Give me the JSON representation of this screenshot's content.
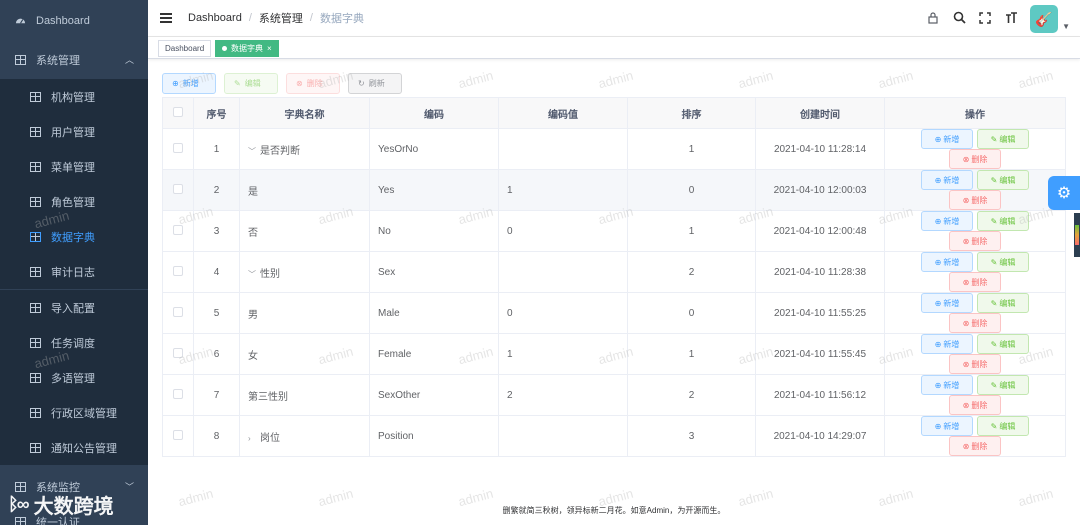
{
  "sidebar": {
    "dashboard": "Dashboard",
    "system_management": "系统管理",
    "items": [
      {
        "label": "机构管理"
      },
      {
        "label": "用户管理"
      },
      {
        "label": "菜单管理"
      },
      {
        "label": "角色管理"
      },
      {
        "label": "数据字典"
      },
      {
        "label": "审计日志"
      },
      {
        "label": "导入配置"
      },
      {
        "label": "任务调度"
      },
      {
        "label": "多语管理"
      },
      {
        "label": "行政区域管理"
      },
      {
        "label": "通知公告管理"
      }
    ],
    "system_monitor": "系统监控",
    "system_tool": "统一认证",
    "logo_text": "大数跨境",
    "active_color": "#409eff"
  },
  "header": {
    "breadcrumb": [
      "Dashboard",
      "系统管理",
      "数据字典"
    ]
  },
  "tags": {
    "dashboard": "Dashboard",
    "active": "数据字典",
    "close": "×"
  },
  "toolbar": {
    "add": "新增",
    "edit": "编辑",
    "delete": "删除",
    "refresh": "刷新"
  },
  "table": {
    "headers": [
      "序号",
      "字典名称",
      "编码",
      "编码值",
      "排序",
      "创建时间",
      "操作"
    ],
    "rows": [
      {
        "seq": "1",
        "name": "是否判断",
        "code": "YesOrNo",
        "value": "",
        "sort": "1",
        "time": "2021-04-10 11:28:14"
      },
      {
        "seq": "2",
        "name": "是",
        "code": "Yes",
        "value": "1",
        "sort": "0",
        "time": "2021-04-10 12:00:03"
      },
      {
        "seq": "3",
        "name": "否",
        "code": "No",
        "value": "0",
        "sort": "1",
        "time": "2021-04-10 12:00:48"
      },
      {
        "seq": "4",
        "name": "性别",
        "code": "Sex",
        "value": "",
        "sort": "2",
        "time": "2021-04-10 11:28:38"
      },
      {
        "seq": "5",
        "name": "男",
        "code": "Male",
        "value": "0",
        "sort": "0",
        "time": "2021-04-10 11:55:25"
      },
      {
        "seq": "6",
        "name": "女",
        "code": "Female",
        "value": "1",
        "sort": "1",
        "time": "2021-04-10 11:55:45"
      },
      {
        "seq": "7",
        "name": "第三性别",
        "code": "SexOther",
        "value": "2",
        "sort": "2",
        "time": "2021-04-10 11:56:12"
      },
      {
        "seq": "8",
        "name": "岗位",
        "code": "Position",
        "value": "",
        "sort": "3",
        "time": "2021-04-10 14:29:07"
      }
    ],
    "ops": {
      "add": "新增",
      "edit": "编辑",
      "delete": "删除"
    }
  },
  "footer": "删繁就简三秋树，领异标新二月花。如意Admin，为开源而生。",
  "watermark": "admin"
}
